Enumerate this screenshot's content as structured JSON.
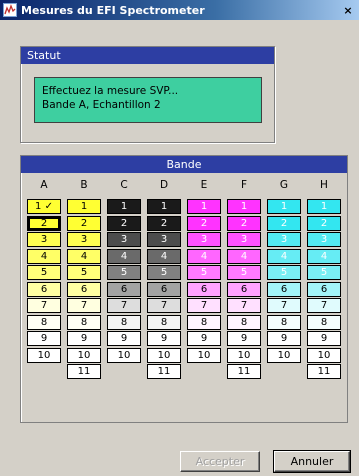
{
  "window": {
    "title": "Mesures du EFI Spectrometer",
    "close_label": "×"
  },
  "statut": {
    "header": "Statut",
    "line1": "Effectuez la mesure SVP...",
    "line2": "Bande A, Echantillon 2"
  },
  "bande": {
    "header": "Bande",
    "columns": [
      {
        "label": "A",
        "color": "#ffff33",
        "text_color": "#000000",
        "rows": [
          "1 ✓",
          "2",
          "3",
          "4",
          "5",
          "6",
          "7",
          "8",
          "9",
          "10"
        ]
      },
      {
        "label": "B",
        "color": "#ffff33",
        "text_color": "#000000",
        "rows": [
          "1",
          "2",
          "3",
          "4",
          "5",
          "6",
          "7",
          "8",
          "9",
          "10",
          "11"
        ]
      },
      {
        "label": "C",
        "color": "#1a1a1a",
        "text_color": "#ffffff",
        "rows": [
          "1",
          "2",
          "3",
          "4",
          "5",
          "6",
          "7",
          "8",
          "9",
          "10"
        ]
      },
      {
        "label": "D",
        "color": "#1a1a1a",
        "text_color": "#ffffff",
        "rows": [
          "1",
          "2",
          "3",
          "4",
          "5",
          "6",
          "7",
          "8",
          "9",
          "10",
          "11"
        ]
      },
      {
        "label": "E",
        "color": "#ff33ff",
        "text_color": "#ffffff",
        "rows": [
          "1",
          "2",
          "3",
          "4",
          "5",
          "6",
          "7",
          "8",
          "9",
          "10"
        ]
      },
      {
        "label": "F",
        "color": "#ff33ff",
        "text_color": "#ffffff",
        "rows": [
          "1",
          "2",
          "3",
          "4",
          "5",
          "6",
          "7",
          "8",
          "9",
          "10",
          "11"
        ]
      },
      {
        "label": "G",
        "color": "#33e6f0",
        "text_color": "#ffffff",
        "rows": [
          "1",
          "2",
          "3",
          "4",
          "5",
          "6",
          "7",
          "8",
          "9",
          "10"
        ]
      },
      {
        "label": "H",
        "color": "#33e6f0",
        "text_color": "#ffffff",
        "rows": [
          "1",
          "2",
          "3",
          "4",
          "5",
          "6",
          "7",
          "8",
          "9",
          "10",
          "11"
        ]
      }
    ],
    "selected": {
      "column": "A",
      "row": "2"
    }
  },
  "buttons": {
    "accept": "Accepter",
    "cancel": "Annuler"
  }
}
